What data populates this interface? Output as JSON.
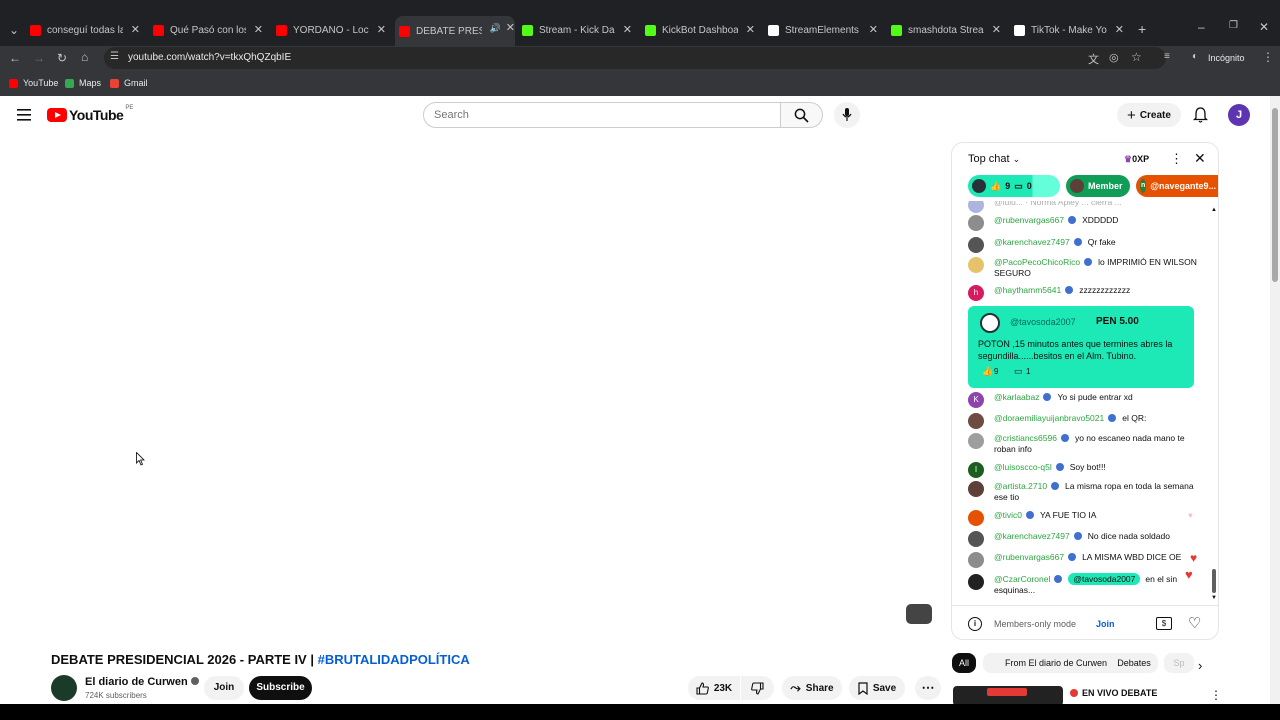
{
  "browser": {
    "tabs": [
      {
        "title": "conseguí todas las m",
        "fav_color": "#ff0000"
      },
      {
        "title": "Qué Pasó con los PR",
        "fav_color": "#ff0000"
      },
      {
        "title": "YORDANO - Locos de",
        "fav_color": "#ff0000"
      },
      {
        "title": "DEBATE PRESIDEN",
        "fav_color": "#ff0000"
      },
      {
        "title": "Stream - Kick Dashb",
        "fav_color": "#53fc18"
      },
      {
        "title": "KickBot Dashboard",
        "fav_color": "#53fc18"
      },
      {
        "title": "StreamElements - em",
        "fav_color": "#ffffff"
      },
      {
        "title": "smashdota Stream -",
        "fav_color": "#53fc18"
      },
      {
        "title": "TikTok - Make Your D",
        "fav_color": "#ffffff"
      }
    ],
    "url": "youtube.com/watch?v=tkxQhQZqbIE",
    "profile_label": "Incógnito",
    "bookmarks": [
      {
        "label": "YouTube",
        "color": "#ff0000"
      },
      {
        "label": "Maps",
        "color": "#34a853"
      },
      {
        "label": "Gmail",
        "color": "#ea4335"
      }
    ]
  },
  "header": {
    "logo_text": "YouTube",
    "country": "PE",
    "search_placeholder": "Search",
    "create_label": "Create",
    "avatar_letter": "J"
  },
  "video": {
    "title": "DEBATE PRESIDENCIAL 2026 - PARTE IV | ",
    "hashtag": "#BRUTALIDADPOLÍTICA",
    "channel": "El diario de Curwen",
    "subscribers": "724K subscribers",
    "join_label": "Join",
    "subscribe_label": "Subscribe",
    "likes": "23K",
    "share_label": "Share",
    "save_label": "Save"
  },
  "chat": {
    "title": "Top chat",
    "xp": "0XP",
    "chips": [
      {
        "label": "9",
        "sub": "0"
      },
      {
        "label": "Member"
      },
      {
        "label": "@navegante9..."
      }
    ],
    "partial_top": "@lulu... · Norma Apley ... cierra ... ",
    "messages": [
      {
        "user": "@rubenvargas667",
        "text": "XDDDDD",
        "avatar_color": "#8d8d8d"
      },
      {
        "user": "@karenchavez7497",
        "text": "Qr fake",
        "avatar_color": "#555555"
      },
      {
        "user": "@PacoPecoChicoRico",
        "text": "lo IMPRIMIÓ EN WILSON SEGURO",
        "avatar_color": "#e6c36a"
      },
      {
        "user": "@haythamm5641",
        "text": "zzzzzzzzzzzz",
        "avatar_color": "#d81b60",
        "letter": "h"
      }
    ],
    "superchat": {
      "user": "@tavosoda2007",
      "amount": "PEN 5.00",
      "text": "POTON ,15 minutos antes que termines abres la segundilla......besitos en el Alm. Tubino.",
      "likes": "9",
      "replies": "1"
    },
    "messages2": [
      {
        "user": "@karlaabaz",
        "text": "Yo si pude entrar xd",
        "avatar_color": "#8e44ad",
        "letter": "K"
      },
      {
        "user": "@doraemiliayuijanbravo5021",
        "text": "el QR:",
        "avatar_color": "#6d4c41"
      },
      {
        "user": "@cristiancs6596",
        "text": "yo no escaneo nada mano te roban info",
        "avatar_color": "#9e9e9e"
      },
      {
        "user": "@luisoscco-q5l",
        "text": "Soy bot!!!",
        "avatar_color": "#1b5e20",
        "letter": "l"
      },
      {
        "user": "@artista.2710",
        "text": "La misma ropa en toda la semana ese tio",
        "avatar_color": "#5d4037"
      },
      {
        "user": "@tivic0",
        "text": "YA FUE TIO IA",
        "avatar_color": "#e65100"
      },
      {
        "user": "@karenchavez7497",
        "text": "No dice nada soldado",
        "avatar_color": "#555555"
      },
      {
        "user": "@rubenvargas667",
        "text": "LA MISMA WBD DICE OE",
        "avatar_color": "#8d8d8d"
      },
      {
        "user": "@CzarCoronel",
        "mention": "@tavosoda2007",
        "text": "en el sin esquinas...",
        "avatar_color": "#212121"
      }
    ],
    "footer_label": "Members-only mode",
    "footer_join": "Join"
  },
  "related": {
    "chips": [
      "All",
      "From El diario de Curwen",
      "Debates",
      "Sp"
    ],
    "first_title": "EN VIVO DEBATE"
  }
}
